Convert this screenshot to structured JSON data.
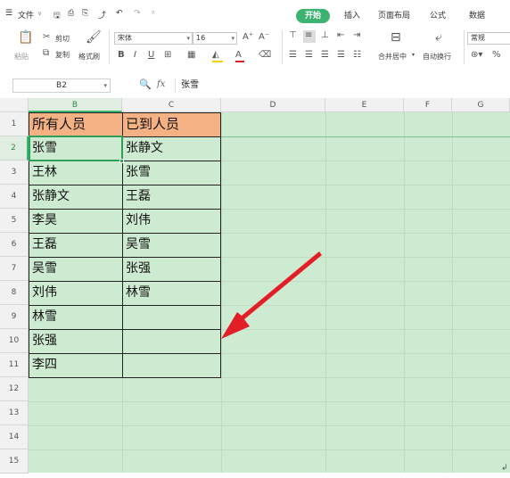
{
  "menubar": {
    "file_menu": "文件",
    "tabs": [
      "开始",
      "插入",
      "页面布局",
      "公式",
      "数据"
    ]
  },
  "ribbon": {
    "paste": "粘贴",
    "cut": "剪切",
    "copy": "复制",
    "format_painter": "格式刷",
    "font_name": "宋体",
    "font_size": "16",
    "merge_center": "合并居中",
    "wrap_text": "自动换行",
    "number_format": "常规"
  },
  "formula_bar": {
    "cell_ref": "B2",
    "fx_label": "fx",
    "content": "张雪"
  },
  "sheet": {
    "columns": [
      "B",
      "C",
      "D",
      "E",
      "F",
      "G"
    ],
    "rows": [
      "1",
      "2",
      "3",
      "4",
      "5",
      "6",
      "7",
      "8",
      "9",
      "10",
      "11",
      "12",
      "13",
      "14",
      "15"
    ],
    "header_b": "所有人员",
    "header_c": "已到人员",
    "col_b": [
      "张雪",
      "王林",
      "张静文",
      "李昊",
      "王磊",
      "吴雪",
      "刘伟",
      "林雪",
      "张强",
      "李四"
    ],
    "col_c": [
      "张静文",
      "张雪",
      "王磊",
      "刘伟",
      "吴雪",
      "张强",
      "林雪"
    ]
  },
  "colors": {
    "accent": "#3cb371",
    "sheet_bg": "#cdebd0",
    "header_fill": "#f4b183",
    "arrow": "#e21f26"
  }
}
